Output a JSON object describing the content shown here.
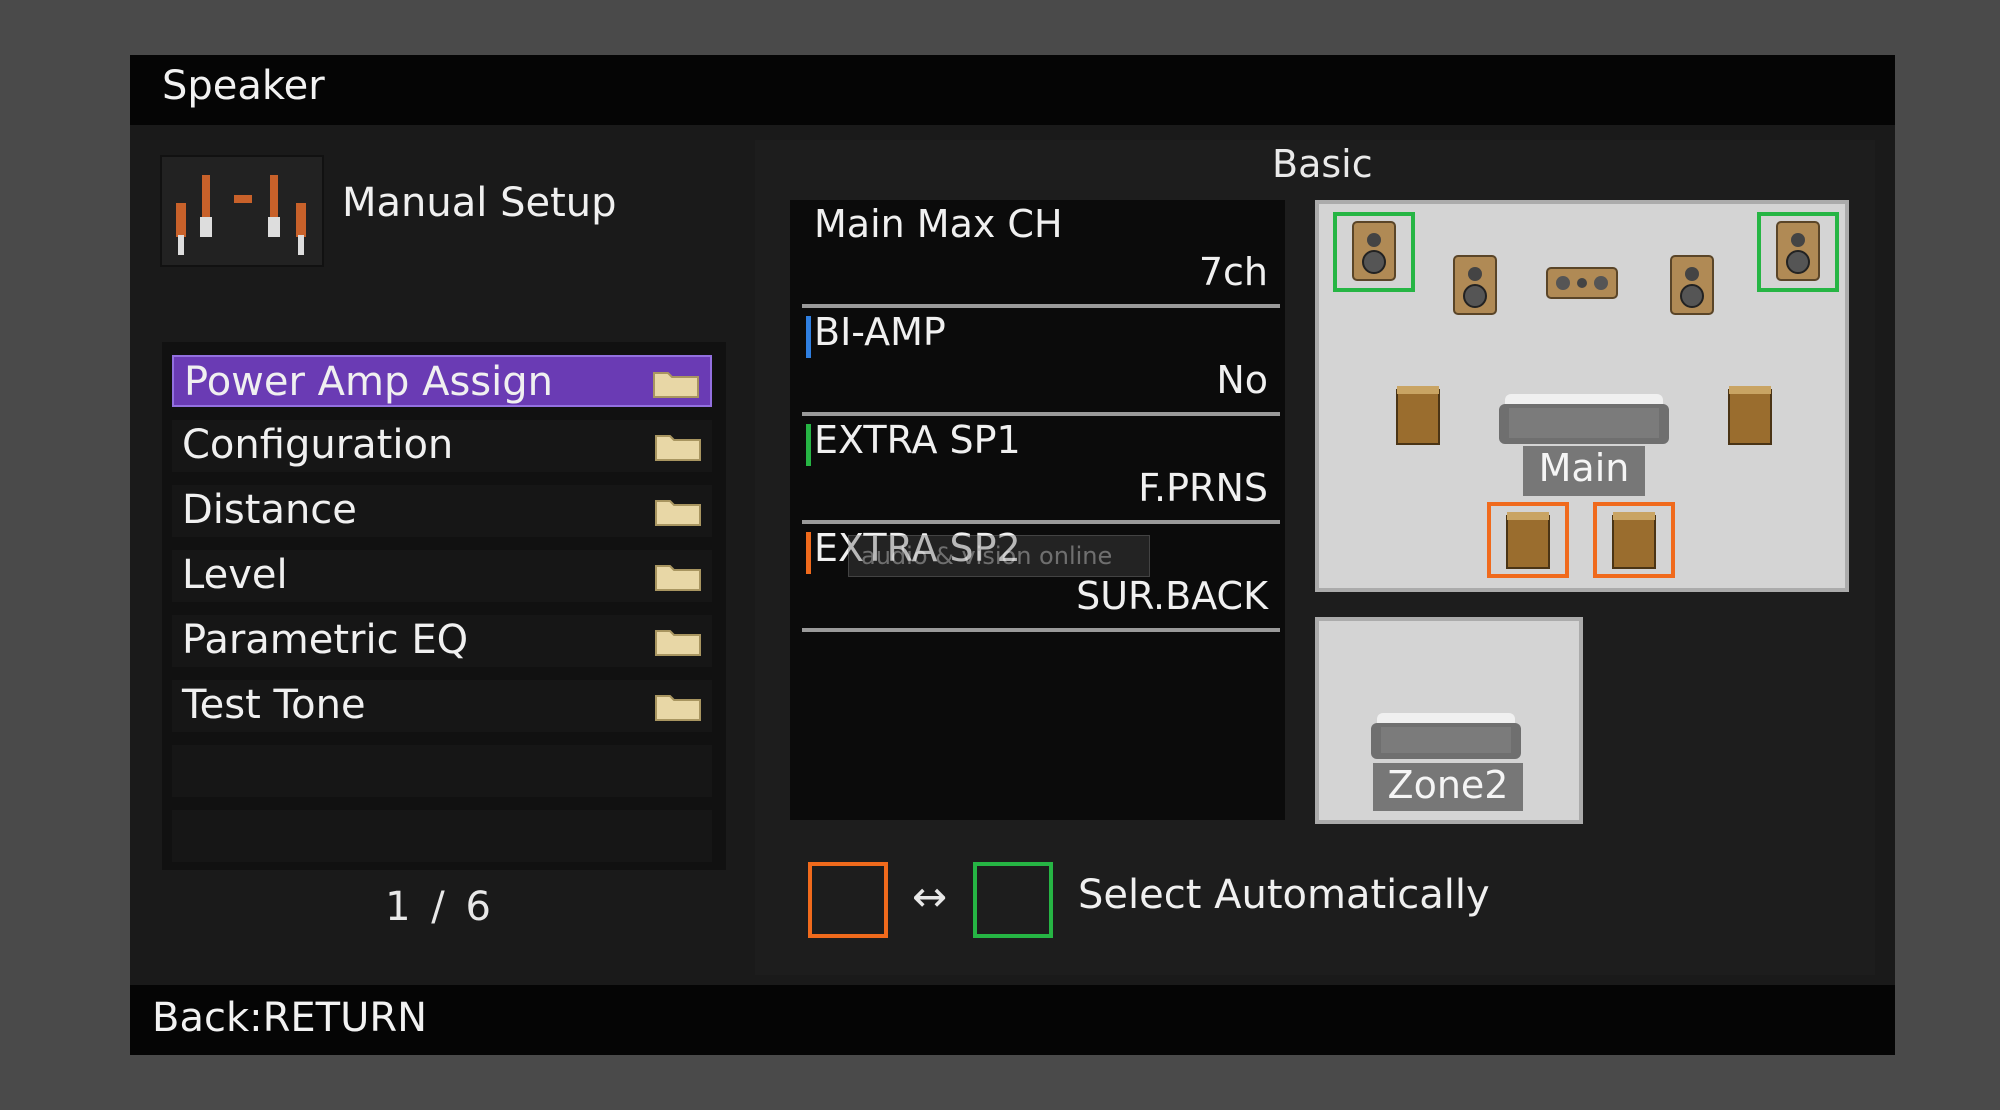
{
  "header": {
    "title": "Speaker"
  },
  "setup": {
    "label": "Manual Setup"
  },
  "menu": {
    "items": [
      {
        "label": "Power Amp Assign"
      },
      {
        "label": "Configuration"
      },
      {
        "label": "Distance"
      },
      {
        "label": "Level"
      },
      {
        "label": "Parametric EQ"
      },
      {
        "label": "Test Tone"
      }
    ],
    "active_index": 0,
    "page": "1 / 6"
  },
  "panel": {
    "mode": "Basic"
  },
  "params": [
    {
      "name": "Main Max CH",
      "value": "7ch",
      "indicator_color": ""
    },
    {
      "name": "BI-AMP",
      "value": "No",
      "indicator_color": "#2f7fe0"
    },
    {
      "name": "EXTRA SP1",
      "value": "F.PRNS",
      "indicator_color": "#26b544"
    },
    {
      "name": "EXTRA SP2",
      "value": "SUR.BACK",
      "indicator_color": "#f06a1c"
    }
  ],
  "rooms": {
    "main_label": "Main",
    "zone2_label": "Zone2"
  },
  "legend": {
    "label": "Select Automatically",
    "arrow": "↔",
    "color_a": "#f06a1c",
    "color_b": "#26b544"
  },
  "footer": {
    "back": "Back:RETURN"
  },
  "watermark": "audio & vision online"
}
